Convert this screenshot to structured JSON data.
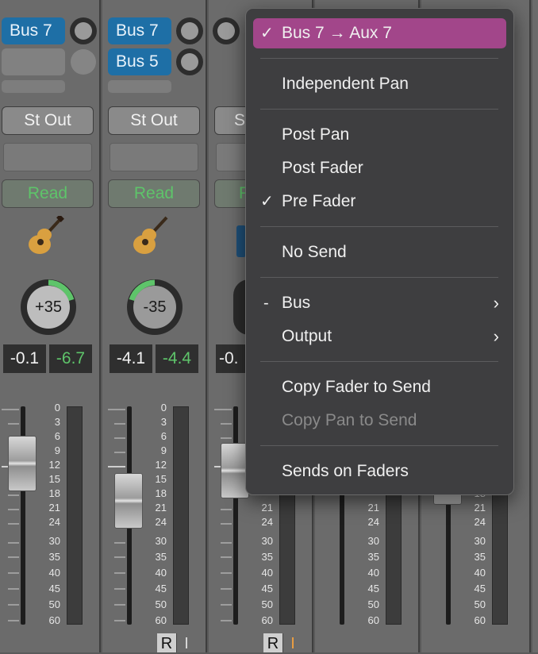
{
  "strips": [
    {
      "send1": "Bus 7",
      "send2": null,
      "output": "St Out",
      "automation": "Read",
      "pan": "+35",
      "vol": "-0.1",
      "peak": "-6.7",
      "r": null,
      "i": null
    },
    {
      "send1": "Bus 7",
      "send2": "Bus 5",
      "output": "St Out",
      "automation": "Read",
      "pan": "-35",
      "vol": "-4.1",
      "peak": "-4.4",
      "r": "R",
      "i": "I"
    },
    {
      "output_partial": "S",
      "automation_partial": "R",
      "vol_partial": "-0.",
      "r": "R",
      "i": "I"
    }
  ],
  "fader_scale": [
    "0",
    "3",
    "6",
    "9",
    "12",
    "15",
    "18",
    "21",
    "24",
    "30",
    "35",
    "40",
    "45",
    "50",
    "60"
  ],
  "menu": {
    "header": {
      "label": "Bus 7 → Aux 7",
      "check": "✓"
    },
    "items": [
      {
        "label": "Independent Pan"
      },
      {
        "label": "Post Pan"
      },
      {
        "label": "Post Fader"
      },
      {
        "label": "Pre Fader",
        "check": "✓"
      },
      {
        "label": "No Send"
      },
      {
        "label": "Bus",
        "mark": "-",
        "arrow": "›"
      },
      {
        "label": "Output",
        "arrow": "›"
      },
      {
        "label": "Copy Fader to Send"
      },
      {
        "label": "Copy Pan to Send"
      },
      {
        "label": "Sends on Faders"
      }
    ]
  },
  "colors": {
    "send_blue": "#1e6fa6",
    "menu_highlight": "#a2468a",
    "read_green": "#5ec46a"
  }
}
